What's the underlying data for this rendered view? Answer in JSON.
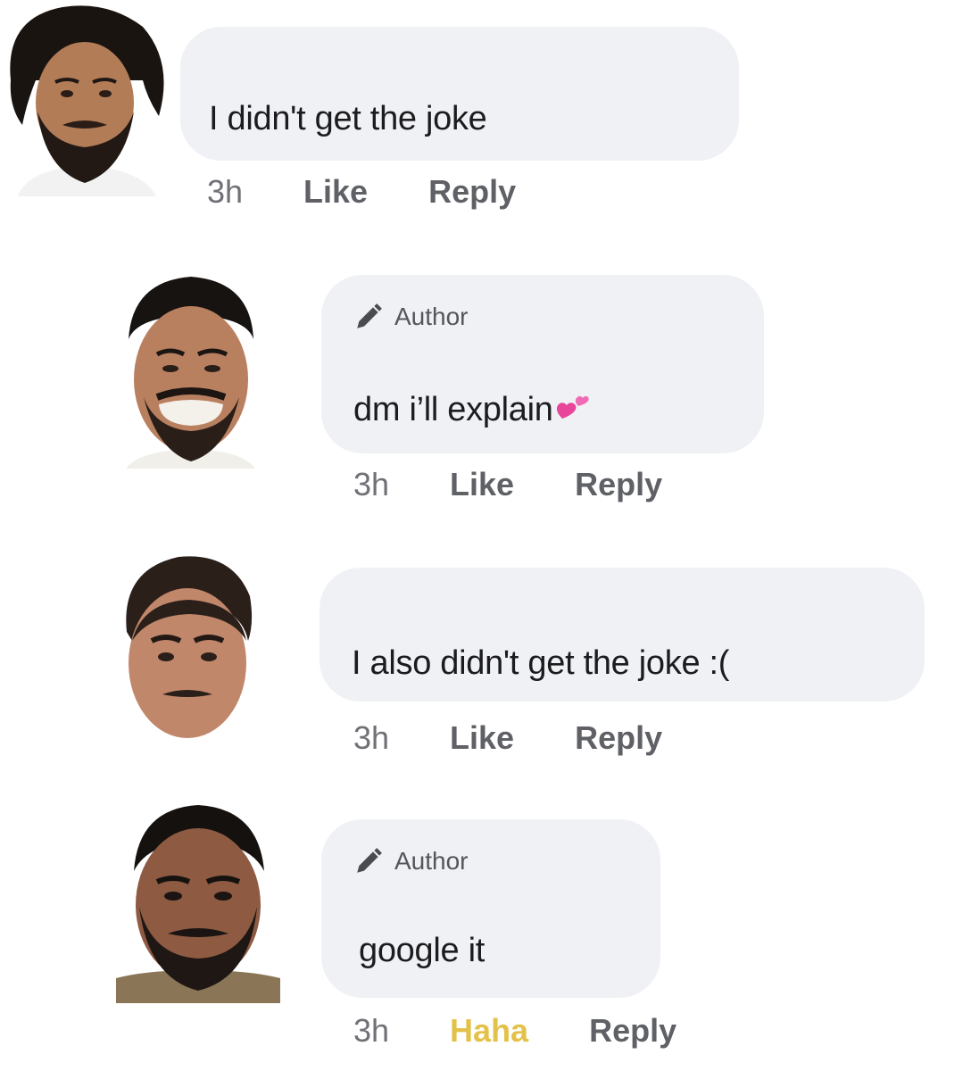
{
  "comments": [
    {
      "avatar": "bearded-man-curly-hair-avatar",
      "author_badge": null,
      "text": "I didn't get the joke",
      "time": "3h",
      "like_label": "Like",
      "reply_label": "Reply"
    },
    {
      "avatar": "smiling-man-mustache-avatar",
      "author_badge": "Author",
      "text": "dm i’ll explain",
      "emoji": "two-hearts-emoji",
      "time": "3h",
      "like_label": "Like",
      "reply_label": "Reply"
    },
    {
      "avatar": "man-styled-hair-mustache-avatar",
      "author_badge": null,
      "text": "I also didn't get the joke :(",
      "time": "3h",
      "like_label": "Like",
      "reply_label": "Reply"
    },
    {
      "avatar": "bearded-man-uniform-avatar",
      "author_badge": "Author",
      "text": "google it",
      "time": "3h",
      "reaction_label": "Haha",
      "reply_label": "Reply"
    }
  ],
  "colors": {
    "bubble": "#f0f1f5",
    "haha": "#e3c24a",
    "action": "#5f6166"
  }
}
